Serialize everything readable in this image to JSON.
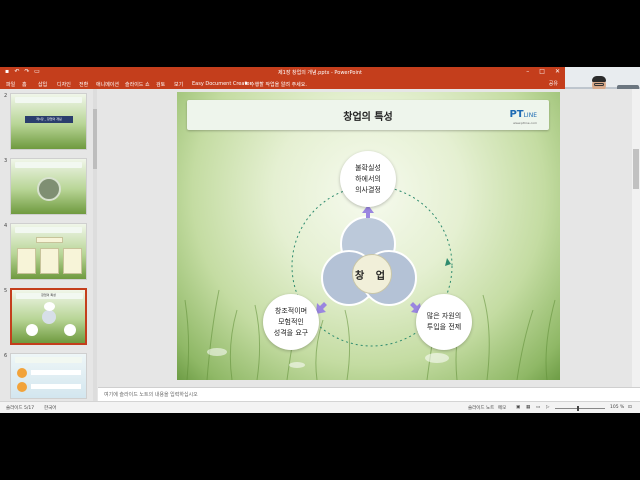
{
  "window": {
    "title": "제1장 창업의 개념.pptx - PowerPoint",
    "min_icon": "minimize-icon",
    "max_icon": "maximize-icon",
    "close_icon": "close-icon"
  },
  "ribbon": {
    "tabs": [
      "파일",
      "홈",
      "삽입",
      "디자인",
      "전환",
      "애니메이션",
      "슬라이드 쇼",
      "검토",
      "보기",
      "Easy Document Creator"
    ],
    "tell_me": "수행할 작업을 알려 주세요.",
    "share": "공유"
  },
  "thumbnails": {
    "items": [
      {
        "num": "2",
        "caption": "제1장 _ 창업의 개념"
      },
      {
        "num": "3",
        "caption": ""
      },
      {
        "num": "4",
        "caption": ""
      },
      {
        "num": "5",
        "caption": "창업의 특성"
      },
      {
        "num": "6",
        "caption": ""
      }
    ],
    "selected_index": 3
  },
  "slide": {
    "title": "창업의 특성",
    "logo_main": "PT",
    "logo_suffix": "LINE",
    "logo_sub": "www.ptline.com",
    "center_label": "창 업",
    "nodes": {
      "top": "불확실성\n하에서의\n의사결정",
      "left": "창조적이며\n모험적인\n성격을 요구",
      "right": "많은 자원의\n투입을 전제"
    },
    "colors": {
      "circle_fill": "#b9c7d9",
      "circle_stroke": "#ffffff",
      "arrow": "#9a86e0",
      "dotted_ring": "#2e8b6e"
    }
  },
  "notes": {
    "placeholder": "여기에 슬라이드 노트의 내용을 입력하십시오"
  },
  "status": {
    "slide_info": "슬라이드 5/17",
    "language": "한국어",
    "notes_label": "슬라이드 노트",
    "comments_label": "메모",
    "zoom": "105 %"
  }
}
